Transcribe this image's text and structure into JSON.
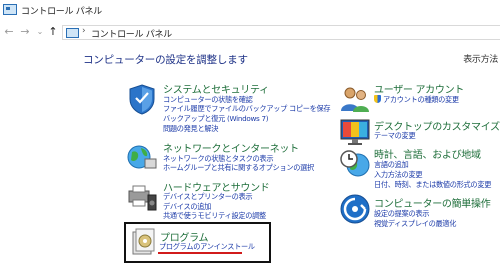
{
  "window": {
    "title": "コントロール パネル"
  },
  "nav": {
    "back_icon": "←",
    "forward_icon": "→",
    "recent_icon": "⌄",
    "up_icon": "↑",
    "breadcrumb_sep": "›",
    "address": "コントロール パネル"
  },
  "main": {
    "heading": "コンピューターの設定を調整します",
    "view_by": "表示方法"
  },
  "categories": [
    {
      "title": "システムとセキュリティ",
      "links": [
        "コンピューターの状態を確認",
        "ファイル履歴でファイルのバックアップ コピーを保存",
        "バックアップと復元 (Windows 7)",
        "問題の発見と解決"
      ]
    },
    {
      "title": "ネットワークとインターネット",
      "links": [
        "ネットワークの状態とタスクの表示",
        "ホームグループと共有に関するオプションの選択"
      ]
    },
    {
      "title": "ハードウェアとサウンド",
      "links": [
        "デバイスとプリンターの表示",
        "デバイスの追加",
        "共通で使うモビリティ設定の調整"
      ]
    },
    {
      "title": "プログラム",
      "links": [
        "プログラムのアンインストール"
      ]
    },
    {
      "title": "ユーザー アカウント",
      "links": [
        "アカウントの種類の変更"
      ]
    },
    {
      "title": "デスクトップのカスタマイズ",
      "links": [
        "テーマの変更"
      ]
    },
    {
      "title": "時計、言語、および地域",
      "links": [
        "言語の追加",
        "入力方法の変更",
        "日付、時刻、または数値の形式の変更"
      ]
    },
    {
      "title": "コンピューターの簡単操作",
      "links": [
        "設定の提案の表示",
        "視覚ディスプレイの最適化"
      ]
    }
  ]
}
